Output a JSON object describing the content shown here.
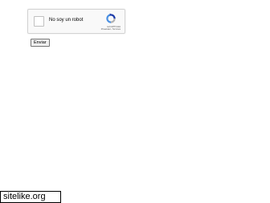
{
  "captcha": {
    "label": "No soy un robot",
    "brand": "reCAPTCHA",
    "links": "Privacidad - Términos",
    "checked": false,
    "logo_icon": "recaptcha-logo-icon",
    "colors": {
      "box_background": "#f9f9f9",
      "box_border": "#d3d3d3",
      "logo_blue": "#4a90e2",
      "logo_dark_blue": "#1c3aa9",
      "logo_gray": "#b1b1b1"
    }
  },
  "form": {
    "submit_label": "Enviar"
  },
  "watermark": {
    "text": "sitelike.org"
  }
}
